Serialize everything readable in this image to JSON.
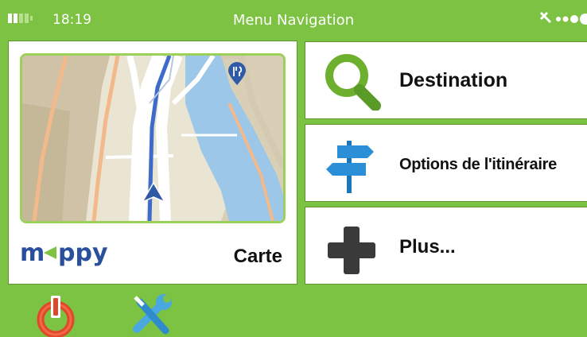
{
  "status_bar": {
    "time": "18:19",
    "title": "Menu Navigation",
    "battery_icon": "battery-icon",
    "gps_icon": "satellite-signal-icon"
  },
  "map_card": {
    "brand": "mappy",
    "label": "Carte",
    "poi_icon": "restaurant-pin-icon",
    "position_icon": "navigation-arrow-icon"
  },
  "menu": {
    "items": [
      {
        "label": "Destination",
        "icon": "magnifier-icon"
      },
      {
        "label": "Options de l'itinéraire",
        "icon": "signpost-icon"
      },
      {
        "label": "Plus...",
        "icon": "plus-icon"
      }
    ]
  },
  "bottom_bar": {
    "power_icon": "power-icon",
    "settings_icon": "wrench-screwdriver-icon"
  },
  "colors": {
    "accent_green": "#7dc243",
    "border_green": "#5e9330",
    "power_red": "#e0482b",
    "tools_blue": "#4aa8e0"
  }
}
